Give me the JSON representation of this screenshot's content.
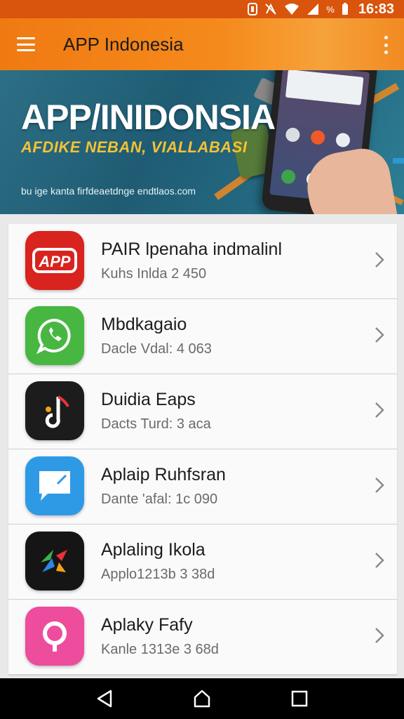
{
  "status_bar": {
    "battery_text": "%",
    "time": "16:83"
  },
  "app_bar": {
    "title": "APP Indonesia"
  },
  "banner": {
    "title": "APP/INIDONSIA",
    "subtitle": "AFDIKE NEBAN, VIALLABASI",
    "url": "bu ige kanta firfdeaetdnge endtlaos.com"
  },
  "apps": [
    {
      "name": "PAIR lpenaha indmalinl",
      "meta": "Kuhs Inlda 2 450",
      "icon": "app-logo-icon",
      "color": "#d8231e"
    },
    {
      "name": "Mbdkagaio",
      "meta": "Dacle Vdal: 4 063",
      "icon": "whatsapp-icon",
      "color": "#47b742"
    },
    {
      "name": "Duidia Eaps",
      "meta": "Dacts Turd: 3 aca",
      "icon": "music-note-icon",
      "color": "#1c1c1c"
    },
    {
      "name": "Aplaip Ruhfsran",
      "meta": "Dante 'afal: 1c 090",
      "icon": "message-icon",
      "color": "#2e9ae6"
    },
    {
      "name": "Aplaling Ikola",
      "meta": "Applo1213b 3 38d",
      "icon": "arrow-logo-icon",
      "color": "#151515"
    },
    {
      "name": "Aplaky Fafy",
      "meta": "Kanle 1313e 3 68d",
      "icon": "q-logo-icon",
      "color": "#ee4c9c"
    }
  ],
  "nav": {
    "back": "back-icon",
    "home": "home-icon",
    "recents": "recents-icon"
  }
}
